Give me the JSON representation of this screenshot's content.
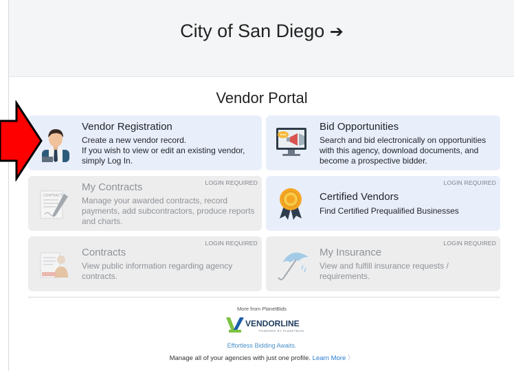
{
  "header": {
    "agency_title": "City of San Diego",
    "agency_arrow": "➔"
  },
  "portal": {
    "title": "Vendor Portal"
  },
  "tiles": [
    {
      "heading": "Vendor Registration",
      "lines": [
        "Create a new vendor record.",
        "If you wish to view or edit an existing vendor,",
        "simply Log In."
      ],
      "badge": "",
      "icon": "vendor-person-icon"
    },
    {
      "heading": "Bid Opportunities",
      "lines": [
        "Search and bid electronically on opportunities",
        "with this agency, download documents, and",
        "become a prospective bidder."
      ],
      "badge": "",
      "icon": "bid-monitor-icon"
    },
    {
      "heading": "My Contracts",
      "lines": [
        "Manage your awarded contracts, record",
        "payments, add subcontractors, produce reports",
        "and charts."
      ],
      "badge": "LOGIN REQUIRED",
      "icon": "contract-document-icon"
    },
    {
      "heading": "Certified Vendors",
      "lines": [
        "Find Certified Prequalified Businesses"
      ],
      "badge": "LOGIN REQUIRED",
      "icon": "award-medal-icon"
    },
    {
      "heading": "Contracts",
      "lines": [
        "View public information regarding agency",
        "contracts."
      ],
      "badge": "LOGIN REQUIRED",
      "icon": "contracts-folder-icon"
    },
    {
      "heading": "My Insurance",
      "lines": [
        "View and fulfill insurance requests /",
        "requirements."
      ],
      "badge": "LOGIN REQUIRED",
      "icon": "umbrella-icon"
    }
  ],
  "footer": {
    "more_from": "More from PlanetBids",
    "logo_text": "VENDORLINE",
    "logo_subtext": "POWERED BY PLANETBIDS",
    "tagline": "Effortless Bidding Awaits.",
    "manage_text": "Manage all of your agencies with just one profile.",
    "learn_more": "Learn More",
    "learn_more_chevron": "〉"
  },
  "colors": {
    "active_tile": "#e9eefb",
    "locked_tile": "#ededee",
    "pointer_arrow": "#ff0000",
    "link": "#2a7bd3",
    "logo_green": "#7cc242",
    "logo_blue": "#1b5fa8"
  }
}
